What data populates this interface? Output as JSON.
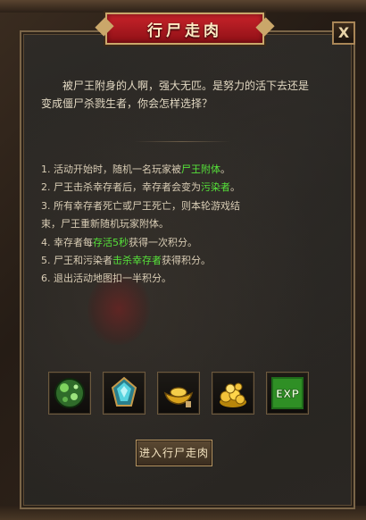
{
  "dialog": {
    "title": "行尸走肉",
    "close_label": "X",
    "intro": "被尸王附身的人啊，强大无匹。是努力的活下去还是变成僵尸杀戮生者，你会怎样选择？"
  },
  "rules": [
    {
      "pre": "1. 活动开始时，随机一名玩家被",
      "hl": "尸王附体",
      "post": "。"
    },
    {
      "pre": "2. 尸王击杀幸存者后，幸存者会变为",
      "hl": "污染者",
      "post": "。"
    },
    {
      "pre": "3. 所有幸存者死亡或尸王死亡，则本轮游戏结",
      "hl": "",
      "post": ""
    },
    {
      "pre": "束，尸王重新随机玩家附体。",
      "hl": "",
      "post": ""
    },
    {
      "pre": "4. 幸存者每",
      "hl": "存活5秒",
      "post": "获得一次积分。"
    },
    {
      "pre": "5. 尸王和污染者",
      "hl": "击杀幸存者",
      "post": "获得积分。"
    },
    {
      "pre": "6. 退出活动地图扣一半积分。",
      "hl": "",
      "post": ""
    }
  ],
  "rewards": [
    {
      "icon": "green-orb-icon"
    },
    {
      "icon": "crystal-gem-icon"
    },
    {
      "icon": "gold-ingot-icon"
    },
    {
      "icon": "gold-coins-icon"
    },
    {
      "icon": "exp-icon",
      "label": "EXP"
    }
  ],
  "enter_button": "进入行尸走肉",
  "colors": {
    "highlight": "#56e23a",
    "title_bg": "#c8232a",
    "frame_gold": "#caa76a"
  }
}
